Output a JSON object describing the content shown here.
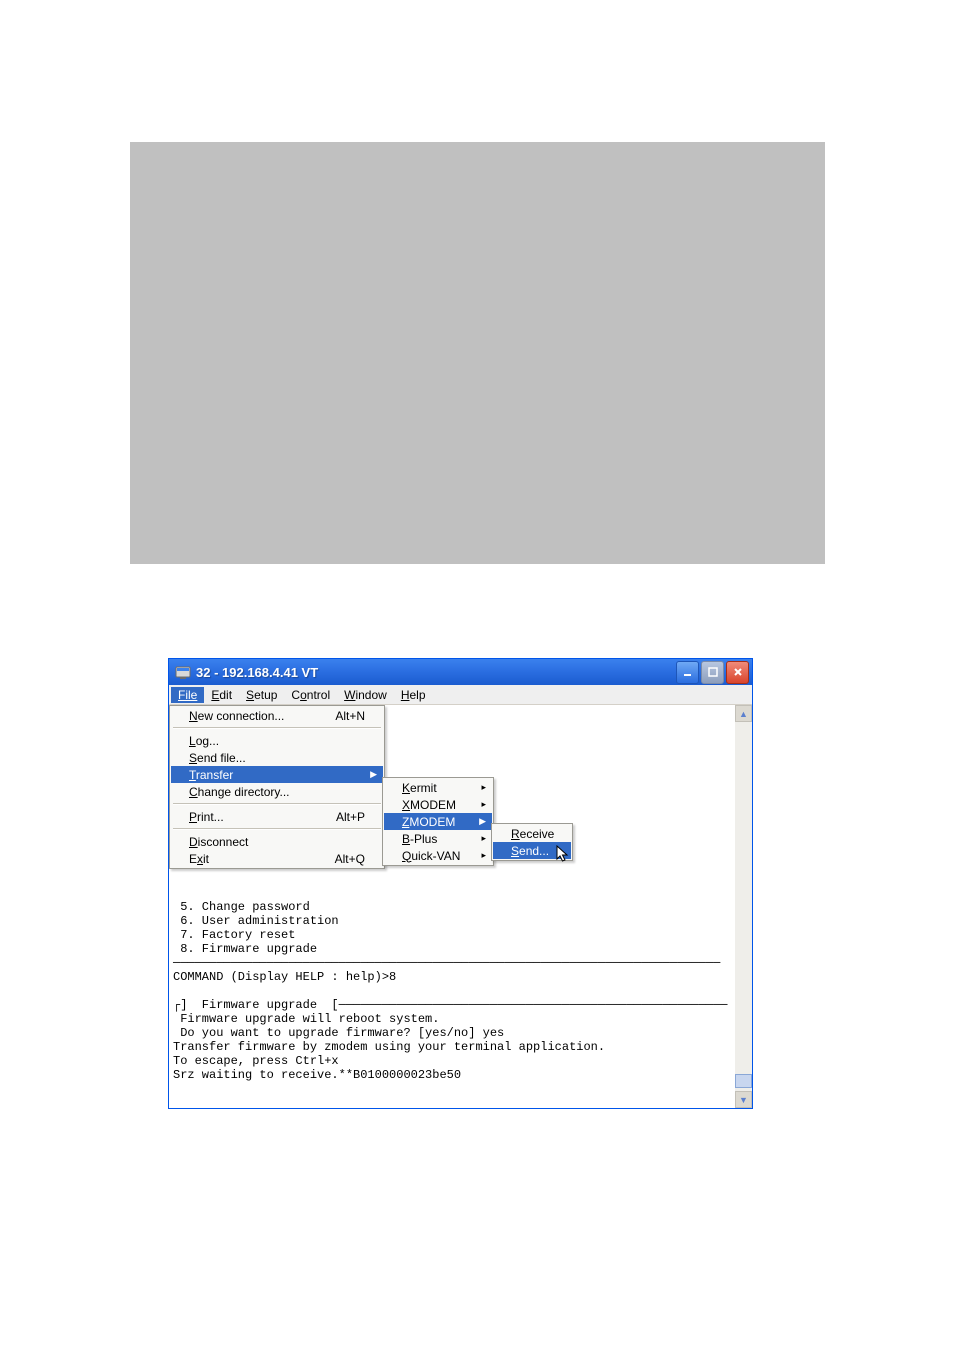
{
  "window_title": "32 - 192.168.4.41 VT",
  "menu_bar": {
    "file": "File",
    "edit": "Edit",
    "setup": "Setup",
    "control": "Control",
    "window": "Window",
    "help": "Help"
  },
  "file_menu": {
    "new_conn": {
      "label": "New connection...",
      "shortcut": "Alt+N"
    },
    "log": "Log...",
    "send_file": "Send file...",
    "transfer": "Transfer",
    "change_dir": "Change directory...",
    "print": {
      "label": "Print...",
      "shortcut": "Alt+P"
    },
    "disconnect": "Disconnect",
    "exit": {
      "label": "Exit",
      "shortcut": "Alt+Q"
    }
  },
  "transfer_menu": {
    "kermit": "Kermit",
    "xmodem": "XMODEM",
    "zmodem": "ZMODEM",
    "bplus": "B-Plus",
    "quickvan": "Quick-VAN"
  },
  "zmodem_menu": {
    "receive": "Receive",
    "send": "Send..."
  },
  "terminal": {
    "line1": " 5. Change password",
    "line2": " 6. User administration",
    "line3": " 7. Factory reset",
    "line4": " 8. Firmware upgrade",
    "line5": "",
    "line6": "COMMAND (Display HELP : help)>8",
    "line7": "",
    "line8_seg1": "]  Firmware upgrade  [",
    "line9": " Firmware upgrade will reboot system.",
    "line10": " Do you want to upgrade firmware? [yes/no] yes",
    "line11": "Transfer firmware by zmodem using your terminal application.",
    "line12": "To escape, press Ctrl+x",
    "line13": "Srz waiting to receive.**B0100000023be50"
  }
}
